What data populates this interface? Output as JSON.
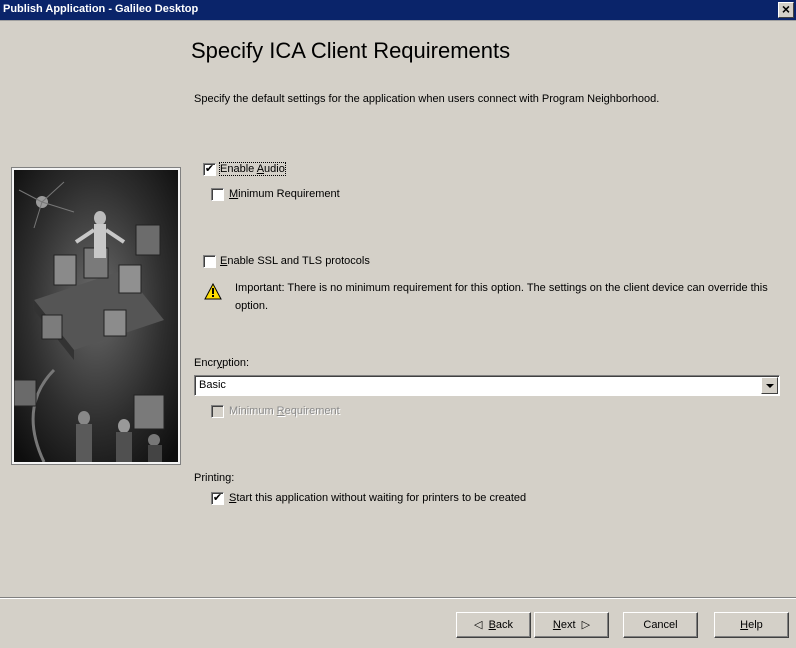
{
  "window": {
    "title": "Publish Application - Galileo Desktop",
    "close_glyph": "×"
  },
  "page": {
    "heading": "Specify ICA Client Requirements",
    "description": "Specify the default settings for the application when users connect with Program Neighborhood."
  },
  "audio": {
    "enable": {
      "label_pre": "Enable ",
      "label_key": "A",
      "label_post": "udio",
      "checked": true
    },
    "minimum": {
      "label_key": "M",
      "label_post": "inimum Requirement",
      "checked": false
    }
  },
  "ssl": {
    "label_key": "E",
    "label_post": "nable SSL and TLS protocols",
    "checked": false,
    "warning": "Important: There is no minimum requirement for this option. The settings on the client device can override this option.",
    "warning_icon": "warning-triangle-icon"
  },
  "encryption": {
    "label_pre": "Encr",
    "label_key": "y",
    "label_post": "ption:",
    "selected": "Basic",
    "minimum": {
      "label_pre": "Minimum ",
      "label_key": "R",
      "label_post": "equirement",
      "checked": false,
      "disabled": true
    }
  },
  "printing": {
    "label": "Printing:",
    "start_without_wait": {
      "label_key": "S",
      "label_post": "tart this application without waiting for printers to be created",
      "checked": true
    }
  },
  "buttons": {
    "back": {
      "glyph": "◁",
      "label_key": "B",
      "label_post": "ack"
    },
    "next": {
      "label_key": "N",
      "label_post": "ext",
      "glyph": "▷"
    },
    "cancel": "Cancel",
    "help": {
      "label_key": "H",
      "label_post": "elp"
    }
  },
  "check_glyph": "✔"
}
